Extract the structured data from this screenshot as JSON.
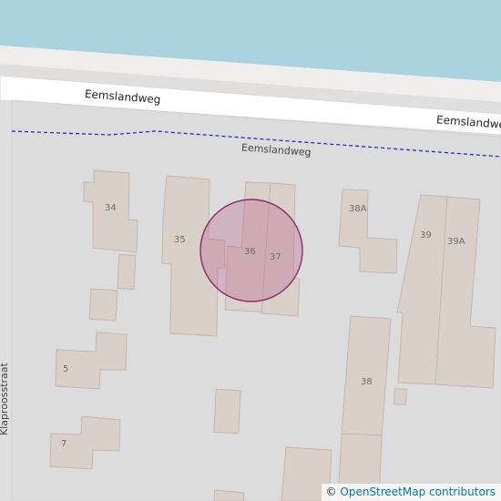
{
  "map": {
    "road_label_main_left": "Eemslandweg",
    "road_label_main_right": "Eemslandweg",
    "road_label_path": "Eemslandweg",
    "side_street_label": "Klaproosstraat",
    "colors": {
      "water": "#aad3df",
      "landuse": "#e0dfdf",
      "road": "#ffffff",
      "building": "#d9d0c9",
      "path_dash": "#1c1cce",
      "marker_fill": "#b85c8a",
      "marker_stroke": "#8b2a6b"
    },
    "house_numbers": [
      {
        "id": "34",
        "label": "34"
      },
      {
        "id": "35",
        "label": "35"
      },
      {
        "id": "36",
        "label": "36"
      },
      {
        "id": "37",
        "label": "37"
      },
      {
        "id": "38A",
        "label": "38A"
      },
      {
        "id": "39",
        "label": "39"
      },
      {
        "id": "39A",
        "label": "39A"
      },
      {
        "id": "38",
        "label": "38"
      },
      {
        "id": "5",
        "label": "5"
      },
      {
        "id": "7",
        "label": "7"
      }
    ]
  },
  "attribution": {
    "symbol": "©",
    "link_text": "OpenStreetMap contributors"
  }
}
